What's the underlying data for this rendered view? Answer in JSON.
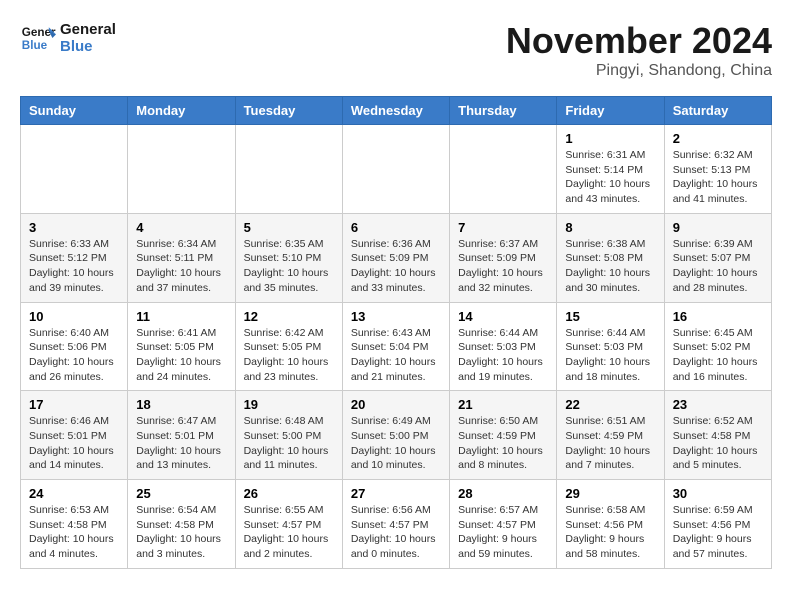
{
  "logo": {
    "line1": "General",
    "line2": "Blue"
  },
  "title": "November 2024",
  "subtitle": "Pingyi, Shandong, China",
  "weekdays": [
    "Sunday",
    "Monday",
    "Tuesday",
    "Wednesday",
    "Thursday",
    "Friday",
    "Saturday"
  ],
  "weeks": [
    [
      {
        "day": "",
        "info": ""
      },
      {
        "day": "",
        "info": ""
      },
      {
        "day": "",
        "info": ""
      },
      {
        "day": "",
        "info": ""
      },
      {
        "day": "",
        "info": ""
      },
      {
        "day": "1",
        "info": "Sunrise: 6:31 AM\nSunset: 5:14 PM\nDaylight: 10 hours and 43 minutes."
      },
      {
        "day": "2",
        "info": "Sunrise: 6:32 AM\nSunset: 5:13 PM\nDaylight: 10 hours and 41 minutes."
      }
    ],
    [
      {
        "day": "3",
        "info": "Sunrise: 6:33 AM\nSunset: 5:12 PM\nDaylight: 10 hours and 39 minutes."
      },
      {
        "day": "4",
        "info": "Sunrise: 6:34 AM\nSunset: 5:11 PM\nDaylight: 10 hours and 37 minutes."
      },
      {
        "day": "5",
        "info": "Sunrise: 6:35 AM\nSunset: 5:10 PM\nDaylight: 10 hours and 35 minutes."
      },
      {
        "day": "6",
        "info": "Sunrise: 6:36 AM\nSunset: 5:09 PM\nDaylight: 10 hours and 33 minutes."
      },
      {
        "day": "7",
        "info": "Sunrise: 6:37 AM\nSunset: 5:09 PM\nDaylight: 10 hours and 32 minutes."
      },
      {
        "day": "8",
        "info": "Sunrise: 6:38 AM\nSunset: 5:08 PM\nDaylight: 10 hours and 30 minutes."
      },
      {
        "day": "9",
        "info": "Sunrise: 6:39 AM\nSunset: 5:07 PM\nDaylight: 10 hours and 28 minutes."
      }
    ],
    [
      {
        "day": "10",
        "info": "Sunrise: 6:40 AM\nSunset: 5:06 PM\nDaylight: 10 hours and 26 minutes."
      },
      {
        "day": "11",
        "info": "Sunrise: 6:41 AM\nSunset: 5:05 PM\nDaylight: 10 hours and 24 minutes."
      },
      {
        "day": "12",
        "info": "Sunrise: 6:42 AM\nSunset: 5:05 PM\nDaylight: 10 hours and 23 minutes."
      },
      {
        "day": "13",
        "info": "Sunrise: 6:43 AM\nSunset: 5:04 PM\nDaylight: 10 hours and 21 minutes."
      },
      {
        "day": "14",
        "info": "Sunrise: 6:44 AM\nSunset: 5:03 PM\nDaylight: 10 hours and 19 minutes."
      },
      {
        "day": "15",
        "info": "Sunrise: 6:44 AM\nSunset: 5:03 PM\nDaylight: 10 hours and 18 minutes."
      },
      {
        "day": "16",
        "info": "Sunrise: 6:45 AM\nSunset: 5:02 PM\nDaylight: 10 hours and 16 minutes."
      }
    ],
    [
      {
        "day": "17",
        "info": "Sunrise: 6:46 AM\nSunset: 5:01 PM\nDaylight: 10 hours and 14 minutes."
      },
      {
        "day": "18",
        "info": "Sunrise: 6:47 AM\nSunset: 5:01 PM\nDaylight: 10 hours and 13 minutes."
      },
      {
        "day": "19",
        "info": "Sunrise: 6:48 AM\nSunset: 5:00 PM\nDaylight: 10 hours and 11 minutes."
      },
      {
        "day": "20",
        "info": "Sunrise: 6:49 AM\nSunset: 5:00 PM\nDaylight: 10 hours and 10 minutes."
      },
      {
        "day": "21",
        "info": "Sunrise: 6:50 AM\nSunset: 4:59 PM\nDaylight: 10 hours and 8 minutes."
      },
      {
        "day": "22",
        "info": "Sunrise: 6:51 AM\nSunset: 4:59 PM\nDaylight: 10 hours and 7 minutes."
      },
      {
        "day": "23",
        "info": "Sunrise: 6:52 AM\nSunset: 4:58 PM\nDaylight: 10 hours and 5 minutes."
      }
    ],
    [
      {
        "day": "24",
        "info": "Sunrise: 6:53 AM\nSunset: 4:58 PM\nDaylight: 10 hours and 4 minutes."
      },
      {
        "day": "25",
        "info": "Sunrise: 6:54 AM\nSunset: 4:58 PM\nDaylight: 10 hours and 3 minutes."
      },
      {
        "day": "26",
        "info": "Sunrise: 6:55 AM\nSunset: 4:57 PM\nDaylight: 10 hours and 2 minutes."
      },
      {
        "day": "27",
        "info": "Sunrise: 6:56 AM\nSunset: 4:57 PM\nDaylight: 10 hours and 0 minutes."
      },
      {
        "day": "28",
        "info": "Sunrise: 6:57 AM\nSunset: 4:57 PM\nDaylight: 9 hours and 59 minutes."
      },
      {
        "day": "29",
        "info": "Sunrise: 6:58 AM\nSunset: 4:56 PM\nDaylight: 9 hours and 58 minutes."
      },
      {
        "day": "30",
        "info": "Sunrise: 6:59 AM\nSunset: 4:56 PM\nDaylight: 9 hours and 57 minutes."
      }
    ]
  ]
}
